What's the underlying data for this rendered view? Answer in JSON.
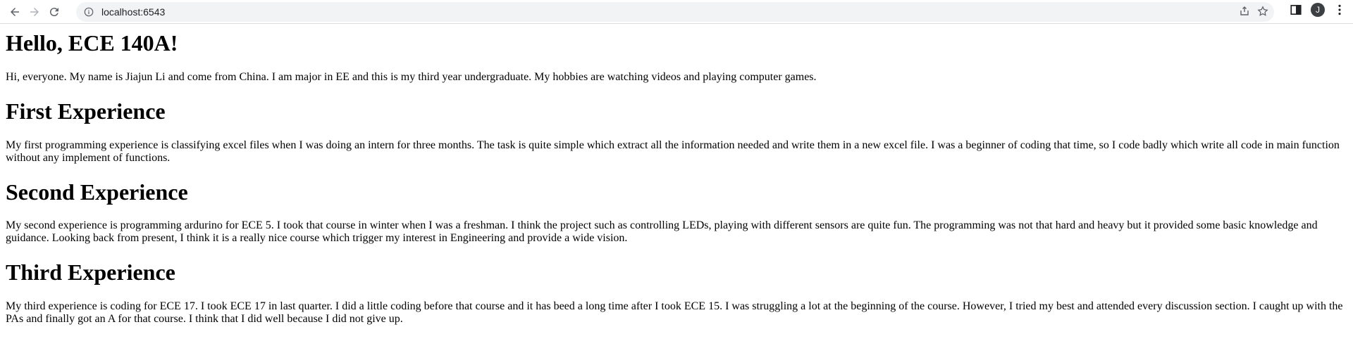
{
  "browser": {
    "url": "localhost:6543",
    "avatar_initial": "J"
  },
  "page": {
    "sections": [
      {
        "heading": "Hello, ECE 140A!",
        "text": "Hi, everyone. My name is Jiajun Li and come from China. I am major in EE and this is my third year undergraduate. My hobbies are watching videos and playing computer games."
      },
      {
        "heading": "First Experience",
        "text": "My first programming experience is classifying excel files when I was doing an intern for three months. The task is quite simple which extract all the information needed and write them in a new excel file. I was a beginner of coding that time, so I code badly which write all code in main function without any implement of functions."
      },
      {
        "heading": "Second Experience",
        "text": "My second experience is programming ardurino for ECE 5. I took that course in winter when I was a freshman. I think the project such as controlling LEDs, playing with different sensors are quite fun. The programming was not that hard and heavy but it provided some basic knowledge and guidance. Looking back from present, I think it is a really nice course which trigger my interest in Engineering and provide a wide vision."
      },
      {
        "heading": "Third Experience",
        "text": "My third experience is coding for ECE 17. I took ECE 17 in last quarter. I did a little coding before that course and it has beed a long time after I took ECE 15. I was struggling a lot at the beginning of the course. However, I tried my best and attended every discussion section. I caught up with the PAs and finally got an A for that course. I think that I did well because I did not give up."
      }
    ]
  }
}
